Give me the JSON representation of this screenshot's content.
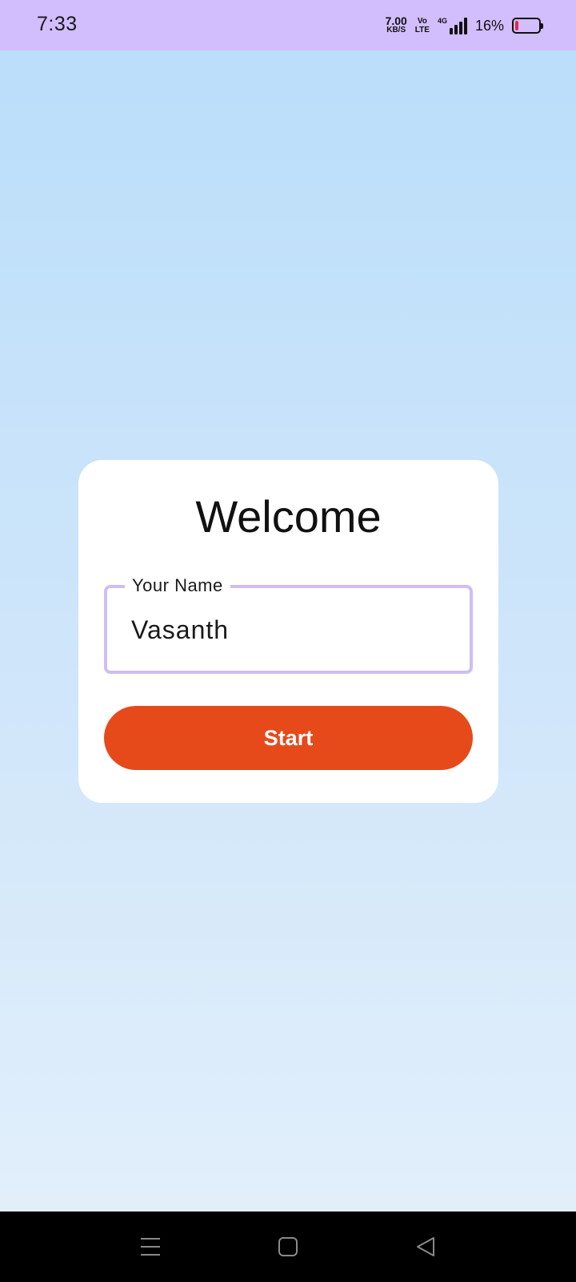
{
  "status_bar": {
    "time": "7:33",
    "net_speed_value": "7.00",
    "net_speed_unit": "KB/S",
    "volte_top": "Vo",
    "volte_bottom": "LTE",
    "network_type": "4G",
    "battery_percent": "16%",
    "battery_level": 0.16,
    "battery_color": "#e8264f"
  },
  "card": {
    "title": "Welcome",
    "name_field": {
      "label": "Your Name",
      "value": "Vasanth"
    },
    "start_button_label": "Start"
  },
  "colors": {
    "status_bar_bg": "#d2bdfd",
    "accent": "#e64a1b",
    "field_outline": "#cfbdf4"
  },
  "nav_bar": {
    "icons": [
      "menu-icon",
      "home-icon",
      "back-icon"
    ]
  }
}
